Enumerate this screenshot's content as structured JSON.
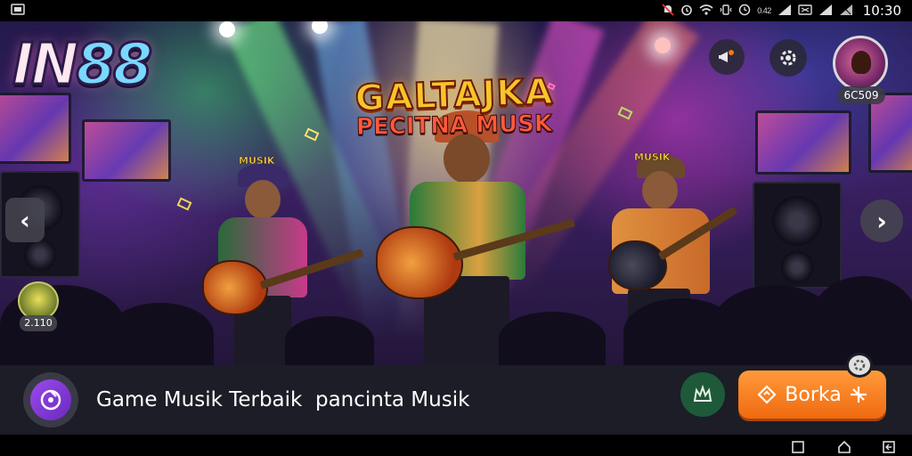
{
  "status_bar": {
    "signal_small": "0.42",
    "time": "10:30"
  },
  "icons": {
    "screenshot": "screenshot-icon",
    "no_notif": "notification-off-icon",
    "alarm": "alarm-icon",
    "wifi": "wifi-icon",
    "vibrate": "vibrate-icon",
    "clock": "clock-icon",
    "signal": "signal-icon",
    "battery": "battery-icon"
  },
  "logo": {
    "part1": "IN",
    "part2": "88"
  },
  "title": {
    "main": "GALTAJKA",
    "sub": "PECITNA MUSK"
  },
  "hat_labels": {
    "left": "MUSIK",
    "right": "MUSIK"
  },
  "top_controls": {
    "avatar_count": "6C509"
  },
  "side": {
    "mini_count": "2.110"
  },
  "bottom_bar": {
    "tagline": "Game Musik Terbaik  pancinta Musik",
    "cta_label": "Borka"
  },
  "colors": {
    "accent": "#f07a1a",
    "bar_bg": "#1c1d26",
    "app_icon": "#8a3ad8",
    "share": "#1e5a3a"
  }
}
